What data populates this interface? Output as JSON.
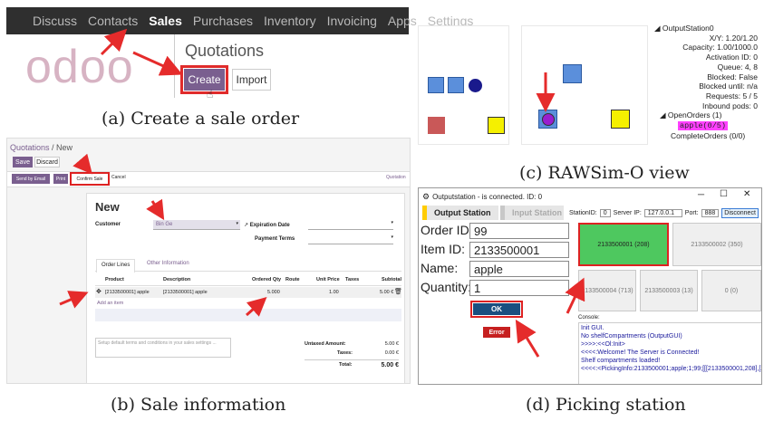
{
  "panel_a": {
    "nav": [
      "Discuss",
      "Contacts",
      "Sales",
      "Purchases",
      "Inventory",
      "Invoicing",
      "Apps",
      "Settings"
    ],
    "active_nav": "Sales",
    "logo": "odoo",
    "title": "Quotations",
    "create_label": "Create",
    "import_label": "Import",
    "caption": "(a) Create a sale order"
  },
  "panel_b": {
    "breadcrumb_root": "Quotations",
    "breadcrumb_sep": " / ",
    "breadcrumb_current": "New",
    "save_label": "Save",
    "discard_label": "Discard",
    "send_email_label": "Send by Email",
    "print_label": "Print",
    "confirm_label": "Confirm Sale",
    "cancel_label": "Cancel",
    "status_label": "Quotation",
    "form_title": "New",
    "customer_label": "Customer",
    "customer_value": "Bin Ge",
    "expiration_label": "Expiration Date",
    "payment_terms_label": "Payment Terms",
    "tabs": [
      "Order Lines",
      "Other Information"
    ],
    "columns": [
      "Product",
      "Description",
      "Ordered Qty",
      "Route",
      "Unit Price",
      "Taxes",
      "Subtotal"
    ],
    "row": {
      "product": "[2133500001] apple",
      "description": "[2133500001] apple",
      "qty": "5.000",
      "route": "",
      "unit_price": "1.00",
      "taxes": "",
      "subtotal": "5.00 €"
    },
    "add_item": "Add an item",
    "terms_placeholder": "Setup default terms and conditions in your sales settings ...",
    "untaxed_label": "Untaxed Amount:",
    "untaxed_value": "5.00 €",
    "taxes_label": "Taxes:",
    "taxes_value": "0.00 €",
    "total_label": "Total:",
    "total_value": "5.00 €",
    "caption": "(b) Sale information"
  },
  "panel_c": {
    "tree_root": "OutputStation0",
    "props": [
      "X/Y: 1.20/1.20",
      "Capacity: 1.00/1000.0",
      "Activation ID: 0",
      "Queue: 4, 8",
      "Blocked: False",
      "Blocked until: n/a",
      "Requests: 5 / 5",
      "Inbound pods: 0"
    ],
    "open_orders": "OpenOrders (1)",
    "order_item": "apple(0/5)",
    "complete_orders": "CompleteOrders (0/0)",
    "caption": "(c) RAWSim-O view"
  },
  "panel_d": {
    "window_title": "Outputstation - is connected. ID: 0",
    "tab_output": "Output Station",
    "tab_input": "Input Station",
    "station_id_label": "StationID:",
    "station_id_value": "0",
    "server_ip_label": "Server IP:",
    "server_ip_value": "127.0.0.1",
    "port_label": "Port:",
    "port_value": "888",
    "disconnect_label": "Disconnect",
    "order_id_label": "Order ID:",
    "order_id_value": "99",
    "item_id_label": "Item ID:",
    "item_id_value": "2133500001",
    "name_label": "Name:",
    "name_value": "apple",
    "quantity_label": "Quantity:",
    "quantity_value": "1",
    "ok_label": "OK",
    "error_label": "Error",
    "tiles": [
      "2133500001 (208)",
      "2133500002 (350)",
      "2133500004 (713)",
      "2133500003 (13)",
      "0 (0)"
    ],
    "console_label": "Console:",
    "console_lines": [
      "Init GUI.",
      "No shelfCompartments (OutputGUI)",
      ">>>>:<<Ol:Init>",
      "<<<<:Welcome! The Server is Connected!",
      "Shelf compartments loaded!",
      "<<<<:<PickingInfo:2133500001;apple;1;99;[[[2133500001,208],[2"
    ],
    "caption": "(d) Picking station"
  }
}
